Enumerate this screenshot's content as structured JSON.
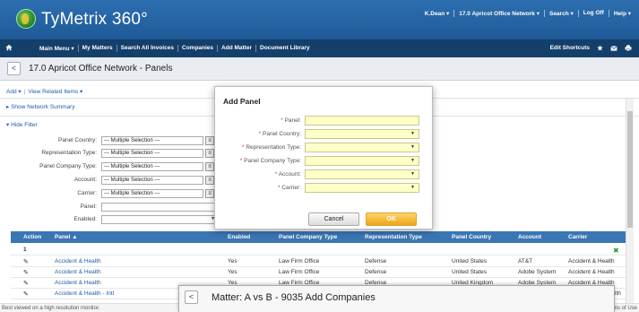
{
  "header": {
    "brand": "TyMetrix 360°",
    "nav": [
      "K.Dean ▾",
      "17.0 Apricot Office Network ▾",
      "Search ▾",
      "Log Off",
      "Help ▾"
    ]
  },
  "menu": {
    "items": [
      "Main Menu ▾",
      "My Matters",
      "Search All Invoices",
      "Companies",
      "Add Matter",
      "Document Library"
    ],
    "edit_shortcuts": "Edit Shortcuts"
  },
  "page": {
    "back": "<",
    "title": "17.0 Apricot Office Network - Panels"
  },
  "subnav": {
    "add": "Add ▾",
    "view_related": "View Related Items ▾",
    "show_summary": "▸ Show Network Summary",
    "hide_filter": "▾ Hide Filter"
  },
  "filters": [
    {
      "label": "Panel Country:",
      "value": "--- Multiple Selection ---"
    },
    {
      "label": "Representation Type:",
      "value": "--- Multiple Selection ---"
    },
    {
      "label": "Panel Company Type:",
      "value": "--- Multiple Selection ---"
    },
    {
      "label": "Account:",
      "value": "--- Multiple Selection ---"
    },
    {
      "label": "Carrier:",
      "value": "--- Multiple Selection ---"
    },
    {
      "label": "Panel:",
      "value": ""
    },
    {
      "label": "Enabled:",
      "value": ""
    }
  ],
  "table": {
    "headers": [
      "Action",
      "Panel ▲",
      "Enabled",
      "Panel Company Type",
      "Representation Type",
      "Panel Country",
      "Account",
      "Carrier"
    ],
    "first_row_num": "1",
    "rows": [
      {
        "panel": "Accident & Health",
        "enabled": "Yes",
        "company_type": "Law Firm Office",
        "rep_type": "Defense",
        "country": "United States",
        "account": "AT&T",
        "carrier": "Accident & Health"
      },
      {
        "panel": "Accident & Health",
        "enabled": "Yes",
        "company_type": "Law Firm Office",
        "rep_type": "Defense",
        "country": "United States",
        "account": "Adobe System",
        "carrier": "Accident & Health"
      },
      {
        "panel": "Accident & Health",
        "enabled": "Yes",
        "company_type": "Law Firm Office",
        "rep_type": "Defense",
        "country": "United Kingdom",
        "account": "Adobe System",
        "carrier": "Accident & Health"
      },
      {
        "panel": "Accident & Health - Intl",
        "enabled": "",
        "company_type": "",
        "rep_type": "",
        "country": "",
        "account": "",
        "carrier": "lth"
      }
    ]
  },
  "modal": {
    "title": "Add Panel",
    "fields": [
      {
        "label": "Panel:",
        "dropdown": false
      },
      {
        "label": "Panel Country:",
        "dropdown": true
      },
      {
        "label": "Representation Type:",
        "dropdown": true
      },
      {
        "label": "Panel Company Type:",
        "dropdown": true
      },
      {
        "label": "Account:",
        "dropdown": true
      },
      {
        "label": "Carrier:",
        "dropdown": true
      }
    ],
    "required_mark": "*",
    "cancel": "Cancel",
    "ok": "OK"
  },
  "second_window": {
    "back": "<",
    "title": "Matter: A vs B  - 9035 Add Companies"
  },
  "footer": {
    "left": "Best viewed on a high resolution monitor.",
    "right": "ms of Use"
  },
  "colors": {
    "header_blue": "#2d6fb0",
    "menu_navy": "#143f6b",
    "table_header": "#3a76b5",
    "required_input": "#ffffc8",
    "ok_orange": "#f0a51a"
  }
}
